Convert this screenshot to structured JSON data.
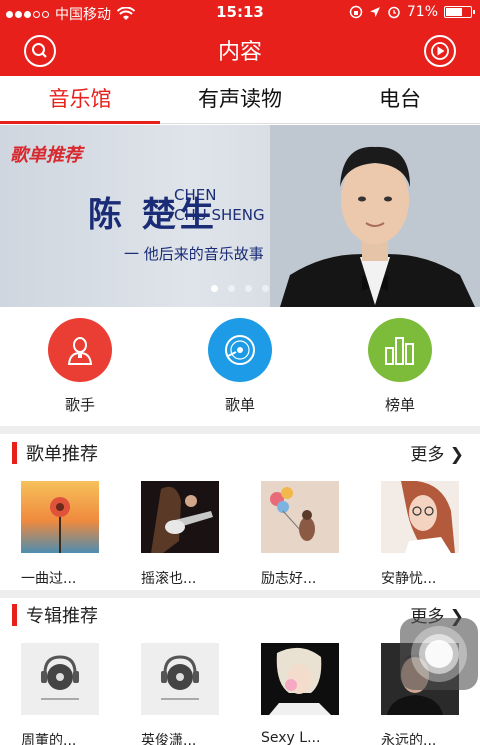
{
  "status_bar": {
    "carrier": "中国移动",
    "time": "15:13",
    "battery": "71%",
    "battery_level": 0.71
  },
  "nav": {
    "title": "内容",
    "left_icon": "search-icon",
    "right_icon": "play-icon"
  },
  "tabs": [
    {
      "label": "音乐馆",
      "active": true
    },
    {
      "label": "有声读物",
      "active": false
    },
    {
      "label": "电台",
      "active": false
    }
  ],
  "banner": {
    "tag": "歌单推荐",
    "name_cn": "陈 楚生",
    "name_en_1": "CHEN",
    "name_en_2": "CHU SHENG",
    "subtitle": "一 他后来的音乐故事",
    "page_count": 4,
    "current_page": 1
  },
  "categories": [
    {
      "label": "歌手",
      "icon": "singer-icon",
      "color": "#ea3d33"
    },
    {
      "label": "歌单",
      "icon": "disc-icon",
      "color": "#1d9be6"
    },
    {
      "label": "榜单",
      "icon": "chart-icon",
      "color": "#7cbc3a"
    }
  ],
  "playlist_section": {
    "title": "歌单推荐",
    "more": "更多",
    "items": [
      {
        "caption": "一曲过..."
      },
      {
        "caption": "摇滚也..."
      },
      {
        "caption": "励志好..."
      },
      {
        "caption": "安静忧..."
      }
    ]
  },
  "album_section": {
    "title": "专辑推荐",
    "more": "更多",
    "items": [
      {
        "caption": "周董的..."
      },
      {
        "caption": "英俊潇..."
      },
      {
        "caption": "Sexy L..."
      },
      {
        "caption": "永远的..."
      }
    ]
  },
  "colors": {
    "brand": "#e8201c"
  }
}
